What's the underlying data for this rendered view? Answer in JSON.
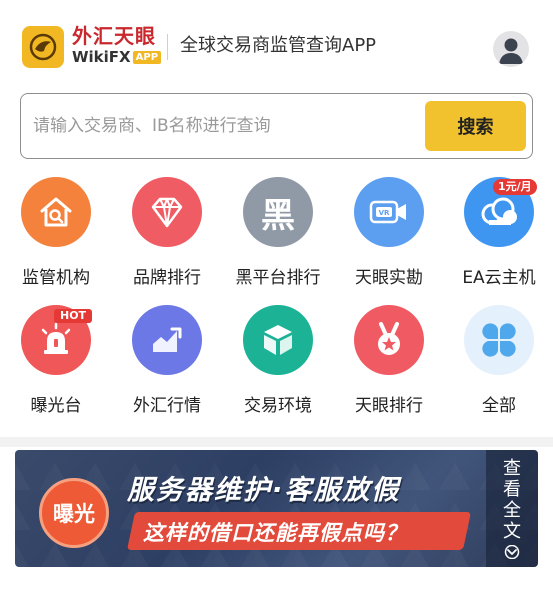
{
  "header": {
    "logo_cn": "外汇天眼",
    "logo_en": "WikiFX",
    "logo_app": "APP",
    "tagline": "全球交易商监管查询APP"
  },
  "search": {
    "placeholder": "请输入交易商、IB名称进行查询",
    "button_label": "搜索"
  },
  "grid": [
    {
      "label": "监管机构",
      "icon": "house-search-icon",
      "color": "#f4823c"
    },
    {
      "label": "品牌排行",
      "icon": "diamond-icon",
      "color": "#f05c63"
    },
    {
      "label": "黑平台排行",
      "icon": "black-text-icon",
      "color": "#909aa6",
      "glyph": "黑"
    },
    {
      "label": "天眼实勘",
      "icon": "vr-camera-icon",
      "color": "#5c9ff0"
    },
    {
      "label": "EA云主机",
      "icon": "cloud-icon",
      "color": "#3e96f1",
      "badge": "1元/月"
    },
    {
      "label": "曝光台",
      "icon": "alarm-light-icon",
      "color": "#f05758",
      "badge": "HOT"
    },
    {
      "label": "外汇行情",
      "icon": "trend-chart-icon",
      "color": "#6c78e6"
    },
    {
      "label": "交易环境",
      "icon": "cube-icon",
      "color": "#1bb296"
    },
    {
      "label": "天眼排行",
      "icon": "medal-icon",
      "color": "#f05b63"
    },
    {
      "label": "全部",
      "icon": "four-grid-icon",
      "color": "#e4f0fb"
    }
  ],
  "banner": {
    "badge": "曝光",
    "title": "服务器维护·客服放假",
    "subtitle": "这样的借口还能再假点吗？",
    "side_label": "查看全文"
  }
}
